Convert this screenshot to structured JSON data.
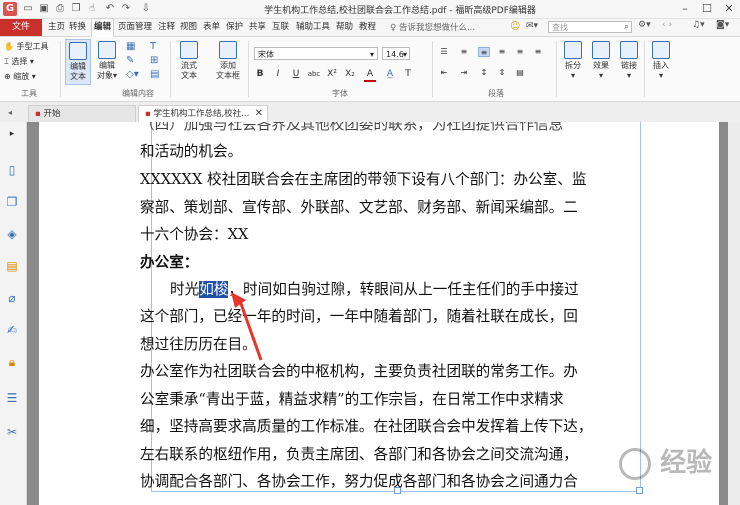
{
  "app": {
    "title": "学生机构工作总结,校社团联合会工作总结.pdf - 福昕高级PDF编辑器"
  },
  "menu": {
    "file": "文件",
    "items": [
      "主页",
      "转换",
      "编辑",
      "页面管理",
      "注释",
      "视图",
      "表单",
      "保护",
      "共享",
      "互联",
      "辅助工具",
      "帮助",
      "教程"
    ],
    "active_index": 2,
    "tellme": "告诉我您想做什么...",
    "search_placeholder": "查找"
  },
  "ribbon": {
    "tools": {
      "hand": "手型工具",
      "select": "选择",
      "zoom": "缩放",
      "group": "工具"
    },
    "edit": {
      "edit_text": [
        "编辑",
        "文本"
      ],
      "edit_object": [
        "编辑",
        "对象"
      ],
      "group": "编辑内容"
    },
    "flow": {
      "flow_text": [
        "流式",
        "文本"
      ],
      "add_text_box": [
        "添加",
        "文本框"
      ]
    },
    "font": {
      "family": "宋体",
      "size": "14.6",
      "group": "字体"
    },
    "paragraph": {
      "group": "段落"
    },
    "split": "拆分",
    "effect": "效果",
    "link": "链接",
    "insert": "插入"
  },
  "tabs": {
    "start": "开始",
    "document": "学生机构工作总结,校社..."
  },
  "document": {
    "lines": [
      "（四）加强与社会各界及其他校团委的联系，为社团提供合作信息",
      "和活动的机会。",
      "XXXXXX 校社团联合会在主席团的带领下设有八个部门：办公室、监",
      "察部、策划部、宣传部、外联部、文艺部、财务部、新闻采编部。二",
      "十六个协会：XX",
      "办公室：",
      "时光",
      "如梭",
      "，时间如白驹过隙，转眼间从上一任主任们的手中接过",
      "这个部门，已经一年的时间，一年中随着部门，随着社联在成长，回",
      "想过往历历在目。",
      "办公室作为社团联合会的中枢机构，主要负责社团联的常务工作。办",
      "公室秉承“青出于蓝，精益求精”的工作宗旨，在日常工作中求精求",
      "细，坚持高要求高质量的工作标准。在社团联合会中发挥着上传下达，",
      "左右联系的枢纽作用，负责主席团、各部门和各协会之间交流沟通，",
      "协调配合各部门、各协会工作，努力促成各部门和各协会之间通力合"
    ],
    "selected_text": "如梭"
  },
  "watermark": "经验",
  "colors": {
    "file_menu": "#c9302c",
    "selection": "#1e4fa8",
    "annotation_arrow": "#e8342a"
  }
}
